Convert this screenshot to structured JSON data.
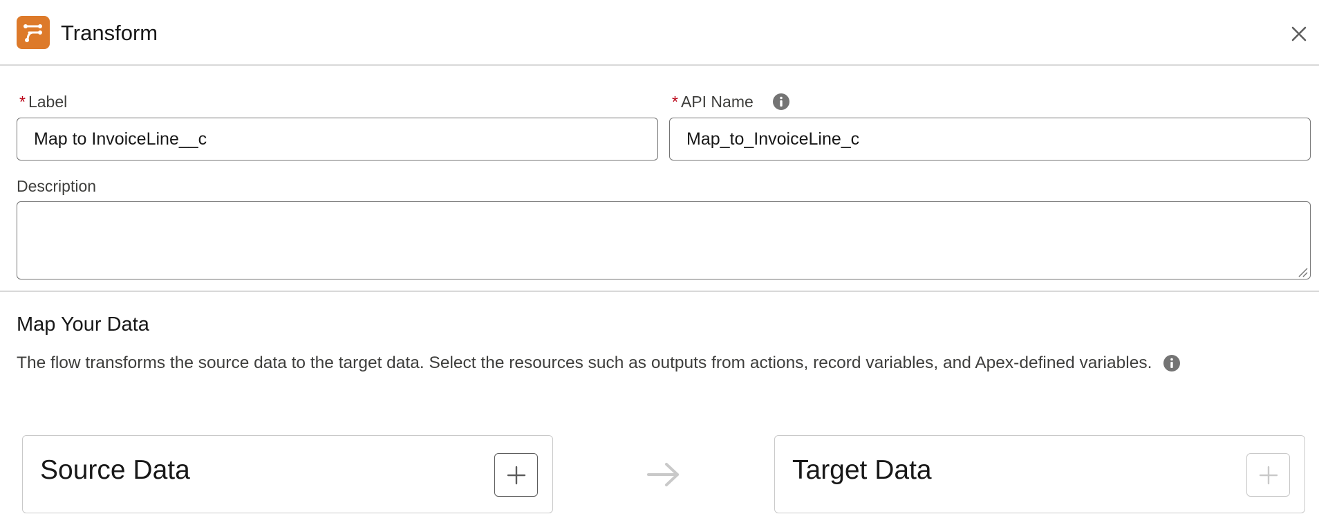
{
  "header": {
    "title": "Transform",
    "icon": "transform-icon",
    "icon_color": "#dd7a2a",
    "close_icon": "close-icon"
  },
  "form": {
    "label_field": {
      "required_marker": "*",
      "label": "Label",
      "value": "Map to InvoiceLine__c"
    },
    "api_name_field": {
      "required_marker": "*",
      "label": "API Name",
      "value": "Map_to_InvoiceLine_c",
      "info_icon": "info-icon"
    },
    "description_field": {
      "label": "Description",
      "value": ""
    }
  },
  "map_section": {
    "title": "Map Your Data",
    "description": "The flow transforms the source data to the target data. Select the resources such as outputs from actions, record variables, and Apex-defined variables.",
    "info_icon": "info-icon"
  },
  "source_card": {
    "title": "Source Data",
    "add_icon": "plus-icon",
    "add_enabled": true
  },
  "target_card": {
    "title": "Target Data",
    "add_icon": "plus-icon",
    "add_enabled": false
  },
  "flow_arrow_icon": "arrow-right-icon",
  "colors": {
    "required": "#ba0517",
    "border": "#747474",
    "divider": "#d8d8d8",
    "info_icon": "#747474"
  }
}
